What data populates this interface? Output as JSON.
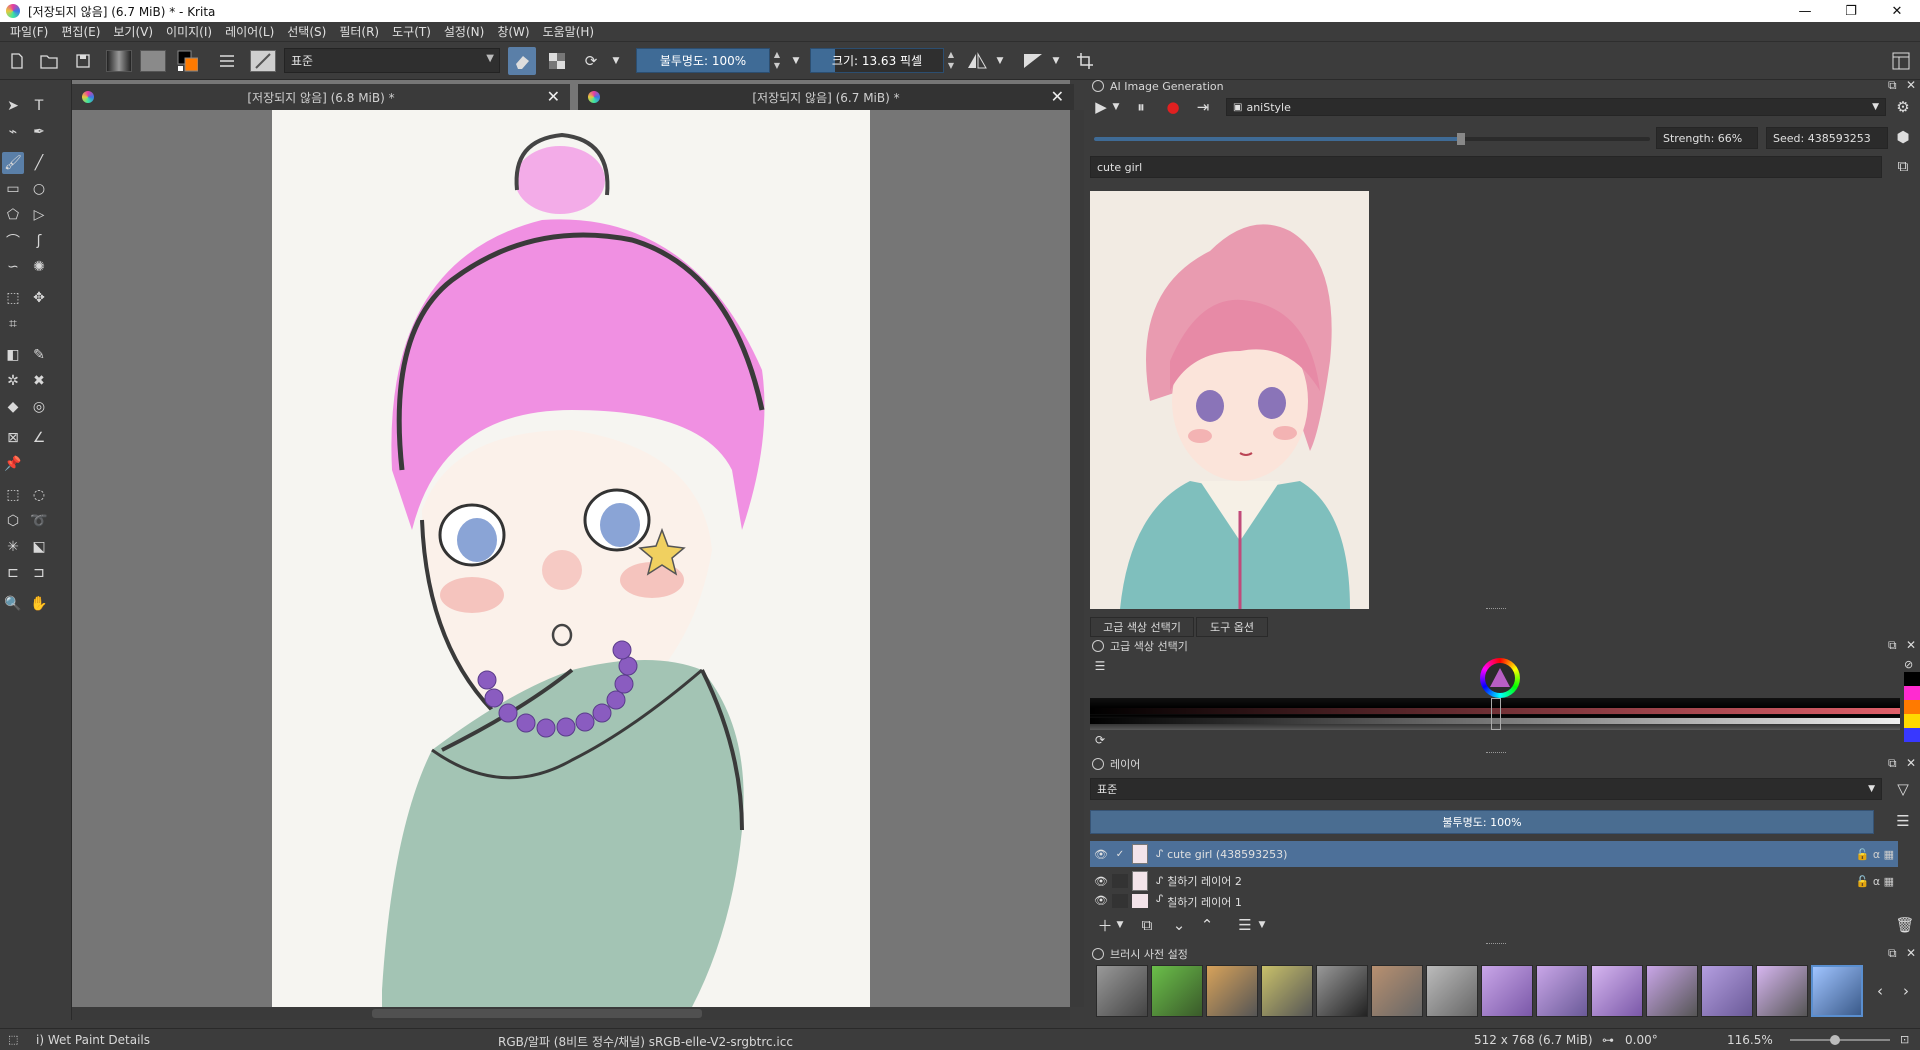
{
  "window": {
    "title": "[저장되지 않음]  (6.7 MiB) * - Krita",
    "minimize_glyph": "—",
    "maximize_glyph": "❐",
    "close_glyph": "✕"
  },
  "menu": [
    "파일(F)",
    "편집(E)",
    "보기(V)",
    "이미지(I)",
    "레이어(L)",
    "선택(S)",
    "필터(R)",
    "도구(T)",
    "설정(N)",
    "창(W)",
    "도움말(H)"
  ],
  "toolbar": {
    "blend_mode": "표준",
    "opacity_label": "불투명도: 100%",
    "size_label": "크기: 13.63 픽셀"
  },
  "tabs": [
    {
      "label": "[저장되지 않음]  (6.8 MiB) *"
    },
    {
      "label": "[저장되지 않음]  (6.7 MiB) *"
    }
  ],
  "ai_panel": {
    "title": "AI Image Generation",
    "style": "aniStyle",
    "strength_label": "Strength: 66%",
    "strength": 0.66,
    "seed_label": "Seed: 438593253",
    "prompt": "cute girl"
  },
  "color_panel": {
    "tab_advanced": "고급 색상 선택기",
    "tab_tool": "도구 옵션",
    "title": "고급 색상 선택기"
  },
  "layers_panel": {
    "title": "레이어",
    "blend_mode": "표준",
    "opacity_label": "불투명도:  100%",
    "layers": [
      {
        "name": "cute girl (438593253)",
        "selected": true
      },
      {
        "name": "칠하기 레이어 2",
        "selected": false
      },
      {
        "name": "칠하기 레이어 1",
        "selected": false
      }
    ]
  },
  "brush_panel": {
    "title": "브러시 사전 설정"
  },
  "status": {
    "brush": "i) Wet Paint Details",
    "colorspace": "RGB/알파 (8비트 정수/채널)  sRGB-elle-V2-srgbtrc.icc",
    "dimensions": "512 x 768 (6.7 MiB)",
    "rotation": "0.00°",
    "zoom": "116.5%"
  },
  "colors": {
    "accent": "#3f6b96",
    "selection": "#4d7099",
    "panel_bg": "#3c3c3c",
    "hair": "#ee8fe0",
    "shirt": "#a3c4b4",
    "beads": "#8a5cc0"
  }
}
